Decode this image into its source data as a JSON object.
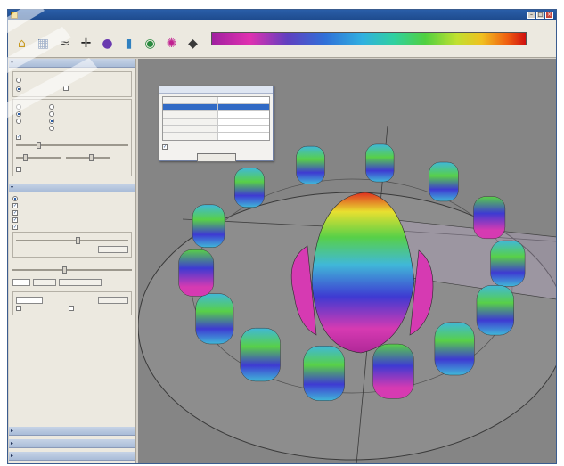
{
  "window": {
    "title": "",
    "min_symbol": "–",
    "max_symbol": "□",
    "close_symbol": "×"
  },
  "menu": [
    "",
    "",
    "",
    "",
    ""
  ],
  "toolbar": {
    "tools": [
      {
        "name": "home-icon",
        "glyph": "⌂",
        "color": "#c89a20"
      },
      {
        "name": "grid-icon",
        "glyph": "▦",
        "color": "#3a5c8f"
      },
      {
        "name": "wave-icon",
        "glyph": "≈",
        "color": "#444444"
      },
      {
        "name": "crosshair-icon",
        "glyph": "✛",
        "color": "#222222"
      },
      {
        "name": "sphere-icon",
        "glyph": "●",
        "color": "#6a3ab0"
      },
      {
        "name": "palette-icon",
        "glyph": "▮",
        "color": "#3080c0"
      },
      {
        "name": "target-icon",
        "glyph": "◉",
        "color": "#2a8a40"
      },
      {
        "name": "spectrum-icon",
        "glyph": "✺",
        "color": "#c02090"
      },
      {
        "name": "diamond-icon",
        "glyph": "◆",
        "color": "#3a3a3a"
      }
    ],
    "palette_ticks": [
      "",
      "",
      "",
      "",
      "",
      "",
      "",
      "",
      "",
      "",
      "",
      "",
      ""
    ]
  },
  "sidebar": {
    "panels": [
      {
        "title": "",
        "collapsed": false
      },
      {
        "title": "",
        "collapsed": false
      },
      {
        "title": "",
        "collapsed": true
      },
      {
        "title": "",
        "collapsed": true
      },
      {
        "title": "",
        "collapsed": true
      }
    ],
    "slider_levels": [
      0.18,
      0.52,
      0.44
    ]
  },
  "dialog": {
    "title": "",
    "rows": [
      {
        "k": "",
        "v": ""
      },
      {
        "k": "",
        "v": ""
      },
      {
        "k": "",
        "v": ""
      },
      {
        "k": "",
        "v": ""
      },
      {
        "k": "",
        "v": ""
      },
      {
        "k": "",
        "v": ""
      }
    ],
    "checkbox_label": "",
    "button_label": ""
  },
  "colors": {
    "magenta": "#d63ab2",
    "blue": "#3e3ad2",
    "cyan": "#40b8d8",
    "green": "#58d048",
    "yellow": "#e8e030",
    "red": "#e03020",
    "floor": "#8d8d8d"
  }
}
